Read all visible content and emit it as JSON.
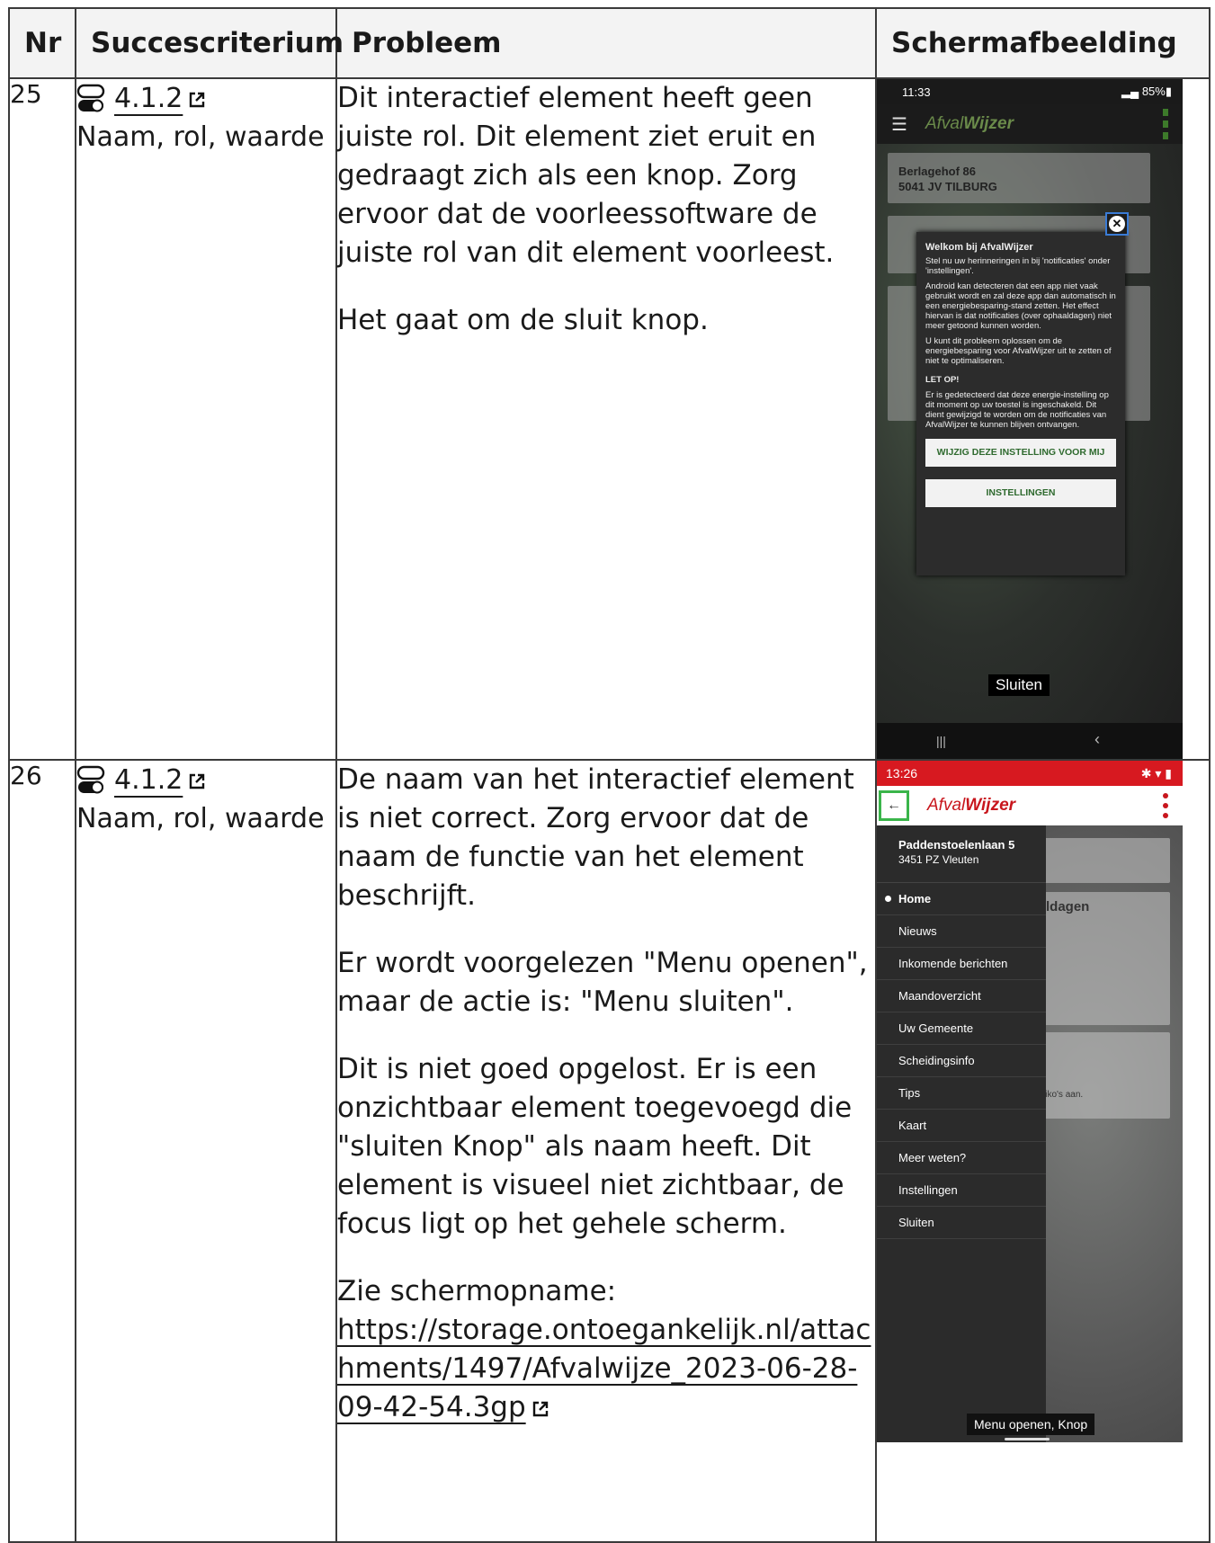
{
  "headers": {
    "nr": "Nr",
    "criterion": "Succescriterium",
    "problem": "Probleem",
    "screenshot": "Schermafbeelding"
  },
  "rows": [
    {
      "nr": "25",
      "criterion_code": "4.1.2",
      "criterion_name": "Naam, rol, waarde",
      "problem": [
        "Dit interactief element heeft geen juiste rol. Dit element ziet eruit en gedraagt zich als een knop. Zorg ervoor dat de voorleessoftware de juiste rol van dit element voorleest.",
        "Het gaat om de sluit knop."
      ],
      "screenshot": {
        "time": "11:33",
        "battery": "85%",
        "brand_light": "Afval",
        "brand_bold": "Wijzer",
        "address_line1": "Berlagehof 86",
        "address_line2": "5041 JV TILBURG",
        "dialog_title": "Welkom bij AfvalWijzer",
        "dialog_p1": "Stel nu uw herinneringen in bij 'notificaties' onder 'instellingen'.",
        "dialog_p2": "Android kan detecteren dat een app niet vaak gebruikt wordt en zal deze app dan automatisch in een energiebesparing-stand zetten. Het effect hiervan is dat notificaties (over ophaaldagen) niet meer getoond kunnen worden.",
        "dialog_p3": "U kunt dit probleem oplossen om de energiebesparing voor AfvalWijzer uit te zetten of niet te optimaliseren.",
        "dialog_letop": "LET OP!",
        "dialog_p4": "Er is gedetecteerd dat deze energie-instelling op dit moment op uw toestel is ingeschakeld. Dit dient gewijzigd te worden om de notificaties van AfvalWijzer te kunnen blijven ontvangen.",
        "button1": "WIJZIG DEZE INSTELLING VOOR MIJ",
        "button2": "INSTELLINGEN",
        "toast": "Sluiten"
      }
    },
    {
      "nr": "26",
      "criterion_code": "4.1.2",
      "criterion_name": "Naam, rol, waarde",
      "problem": [
        "De naam van het interactief element is niet correct. Zorg ervoor dat de naam de functie van het element beschrijft.",
        "Er wordt voorgelezen \"Menu openen\", maar de actie is: \"Menu sluiten\".",
        "Dit is niet goed opgelost. Er is een onzichtbaar element toegevoegd die \"sluiten Knop\" als naam heeft. Dit element is visueel niet zichtbaar, de focus ligt op het gehele scherm.",
        "Zie schermopname:"
      ],
      "link": "https://storage.ontoegankelijk.nl/attachments/1497/Afvalwijze_2023-06-28-09-42-54.3gp",
      "screenshot": {
        "time": "13:26",
        "brand_light": "Afval",
        "brand_bold": "Wijzer",
        "address_line1": "Paddenstoelenlaan 5",
        "address_line2": "3451 PZ Vleuten",
        "menu": [
          "Home",
          "Nieuws",
          "Inkomende berichten",
          "Maandoverzicht",
          "Uw Gemeente",
          "Scheidingsinfo",
          "Tips",
          "Kaart",
          "Meer weten?",
          "Instellingen",
          "Sluiten"
        ],
        "bg_fragment1": "ldagen",
        "bg_fragment2": "kliko's aan.",
        "toast": "Menu openen, Knop"
      }
    }
  ],
  "colors": {
    "brand_red": "#d71920",
    "focus_blue": "#3a7bd5",
    "focus_green": "#3ab54a"
  }
}
